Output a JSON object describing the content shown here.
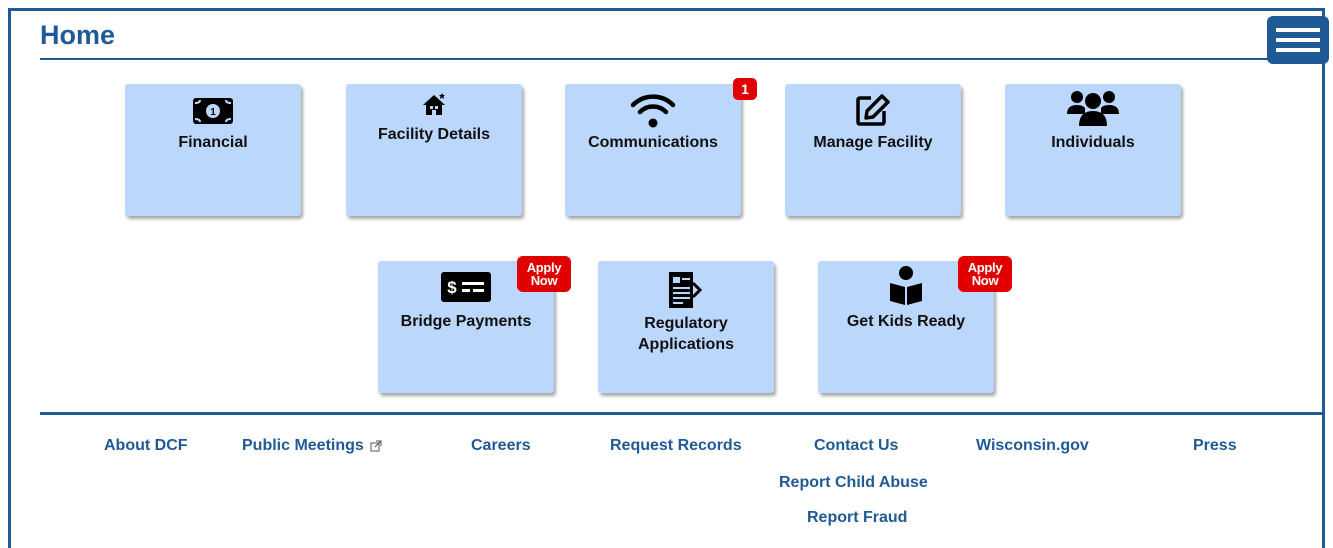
{
  "header": {
    "title": "Home",
    "menu_icon": "hamburger-menu-icon"
  },
  "colors": {
    "primary": "#1f5a96",
    "tile_bg": "#bcd7fc",
    "badge_red": "#e00000"
  },
  "tiles": {
    "financial": {
      "label": "Financial",
      "icon": "money-bill-icon"
    },
    "facility_details": {
      "label": "Facility Details",
      "icon": "house-icon"
    },
    "communications": {
      "label": "Communications",
      "icon": "wifi-icon",
      "badge": "1"
    },
    "manage_facility": {
      "label": "Manage Facility",
      "icon": "edit-icon"
    },
    "individuals": {
      "label": "Individuals",
      "icon": "users-icon"
    },
    "bridge_payments": {
      "label": "Bridge Payments",
      "icon": "check-payment-icon",
      "badge_line1": "Apply",
      "badge_line2": "Now"
    },
    "regulatory_applications": {
      "label_line1": "Regulatory",
      "label_line2": "Applications",
      "icon": "document-icon"
    },
    "get_kids_ready": {
      "label": "Get Kids Ready",
      "icon": "child-reading-icon",
      "badge_line1": "Apply",
      "badge_line2": "Now"
    }
  },
  "footer": {
    "about": "About DCF",
    "public_meetings": "Public Meetings",
    "careers": "Careers",
    "request_records": "Request Records",
    "contact_us": "Contact Us",
    "wisconsin_gov": "Wisconsin.gov",
    "press": "Press",
    "report_child_abuse": "Report Child Abuse",
    "report_fraud": "Report Fraud"
  }
}
